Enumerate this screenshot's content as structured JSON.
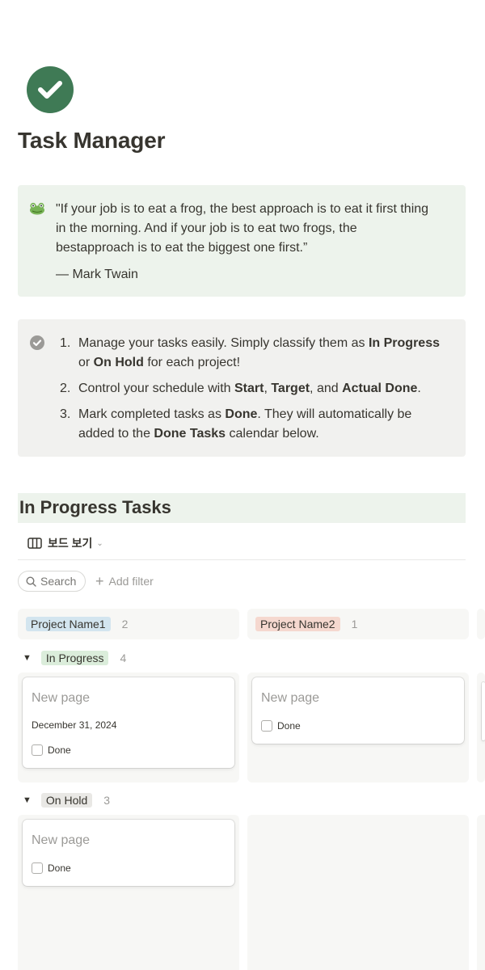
{
  "page": {
    "icon": "check-circle-icon",
    "title": "Task Manager"
  },
  "quote_callout": {
    "icon": "frog-emoji-icon",
    "text": "\"If your job is to eat a frog, the best approach is to eat it first thing in the morning. And if your job is to eat two frogs, the bestapproach is to eat the biggest one first.”",
    "author": "— Mark Twain"
  },
  "steps_callout": {
    "icon": "check-circle-icon",
    "items": [
      {
        "number": "1.",
        "parts": [
          {
            "text": "Manage your tasks easily. Simply classify them as ",
            "bold": false
          },
          {
            "text": "In Progress",
            "bold": true
          },
          {
            "text": " or ",
            "bold": false
          },
          {
            "text": "On Hold",
            "bold": true
          },
          {
            "text": " for each project!",
            "bold": false
          }
        ]
      },
      {
        "number": "2.",
        "parts": [
          {
            "text": "Control your schedule with ",
            "bold": false
          },
          {
            "text": "Start",
            "bold": true
          },
          {
            "text": ", ",
            "bold": false
          },
          {
            "text": "Target",
            "bold": true
          },
          {
            "text": ", and ",
            "bold": false
          },
          {
            "text": "Actual Done",
            "bold": true
          },
          {
            "text": ".",
            "bold": false
          }
        ]
      },
      {
        "number": "3.",
        "parts": [
          {
            "text": "Mark completed tasks as ",
            "bold": false
          },
          {
            "text": "Done",
            "bold": true
          },
          {
            "text": ". They will automatically be added to the ",
            "bold": false
          },
          {
            "text": "Done Tasks",
            "bold": true
          },
          {
            "text": " calendar below.",
            "bold": false
          }
        ]
      }
    ]
  },
  "section": {
    "title": "In Progress Tasks"
  },
  "toolbar": {
    "view_label": "보드 보기",
    "search_label": "Search",
    "add_filter_label": "Add filter"
  },
  "board": {
    "columns": [
      {
        "label": "Project Name1",
        "count": "2",
        "color": "#d3e5ef"
      },
      {
        "label": "Project Name2",
        "count": "1",
        "color": "#f5d8cf"
      }
    ],
    "groups": [
      {
        "label": "In Progress",
        "count": "4",
        "color": "#dbeddb"
      },
      {
        "label": "On Hold",
        "count": "3",
        "color": "#e9e8e5"
      }
    ],
    "cards": {
      "in_progress_col1": {
        "title": "New page",
        "date": "December 31, 2024",
        "checkbox_label": "Done",
        "checked": false
      },
      "in_progress_col2": {
        "title": "New page",
        "checkbox_label": "Done",
        "checked": false
      },
      "on_hold_col1": {
        "title": "New page",
        "checkbox_label": "Done",
        "checked": false
      }
    }
  }
}
